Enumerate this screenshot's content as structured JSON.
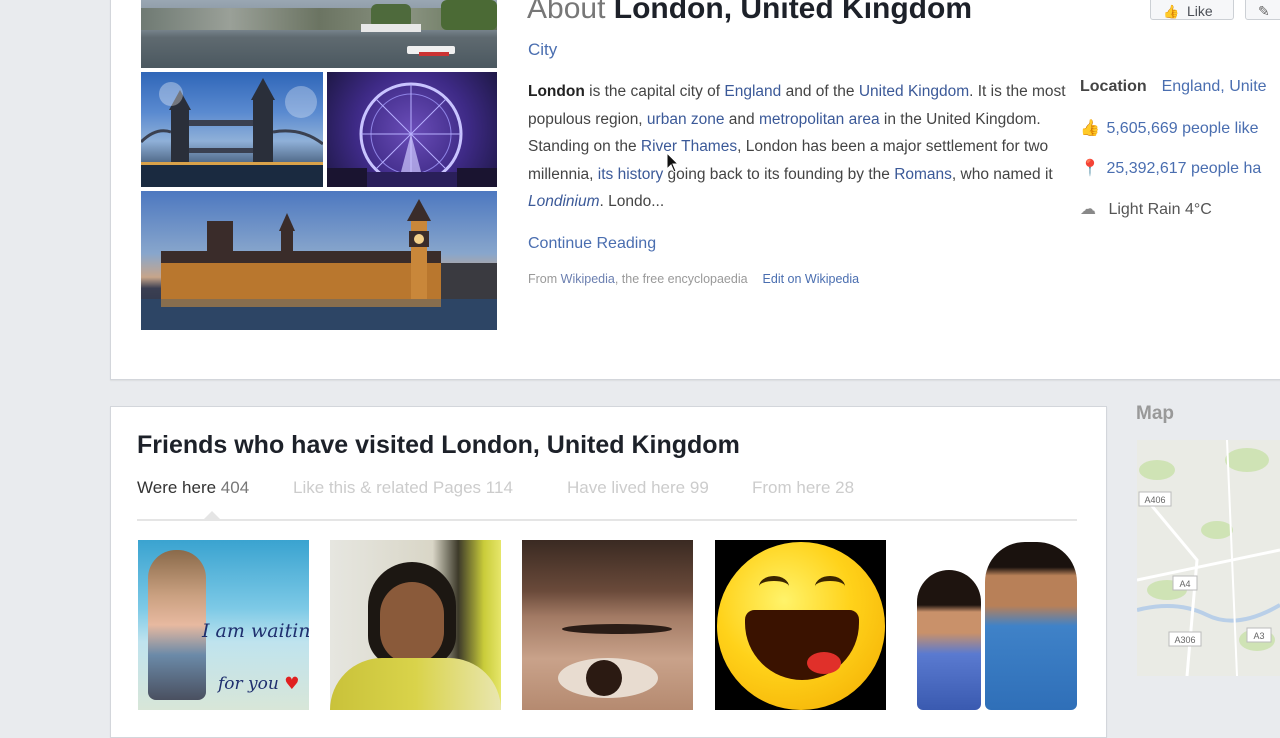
{
  "about": {
    "title_prefix": "About",
    "title_name": "London, United Kingdom",
    "category": "City",
    "like_button": "Like",
    "description": {
      "p1_bold": "London",
      "p2": " is the capital city of ",
      "l1": "England",
      "p3": " and of the ",
      "l2": "United Kingdom",
      "p4": ". It is the most populous region, ",
      "l3": "urban zone",
      "p5": " and ",
      "l4": "metropolitan area",
      "p6": " in the United Kingdom. Standing on the ",
      "l5": "River Thames",
      "p7": ", London has been a major settlement for two millennia, ",
      "l6": "its history",
      "p8": " going back to its founding by the ",
      "l7": "Romans",
      "p9": ", who named it ",
      "l8": "Londinium",
      "p10": ". Londo..."
    },
    "continue_reading": "Continue Reading",
    "source_prefix": "From ",
    "source_link": "Wikipedia",
    "source_suffix": ", the free encyclopaedia",
    "edit_link": "Edit on Wikipedia",
    "sidebar": {
      "location_label": "Location",
      "location_value": "England, Unite",
      "likes": "5,605,669 people like",
      "visits": "25,392,617 people ha",
      "weather": "Light Rain 4°C"
    }
  },
  "friends": {
    "title": "Friends who have visited London, United Kingdom",
    "tabs": [
      {
        "label": "Were here",
        "count": "404"
      },
      {
        "label": "Like this & related Pages",
        "count": "114"
      },
      {
        "label": "Have lived here",
        "count": "99"
      },
      {
        "label": "From here",
        "count": "28"
      }
    ],
    "photo1_text": {
      "line1": "I am waiting",
      "line2": "for you"
    }
  },
  "map": {
    "title": "Map",
    "road_labels": [
      "A406",
      "A4",
      "A306",
      "A3"
    ]
  },
  "colors": {
    "link": "#3b5998",
    "sky_blue": "#2d6fc0",
    "night_purple": "#3e2a86"
  }
}
